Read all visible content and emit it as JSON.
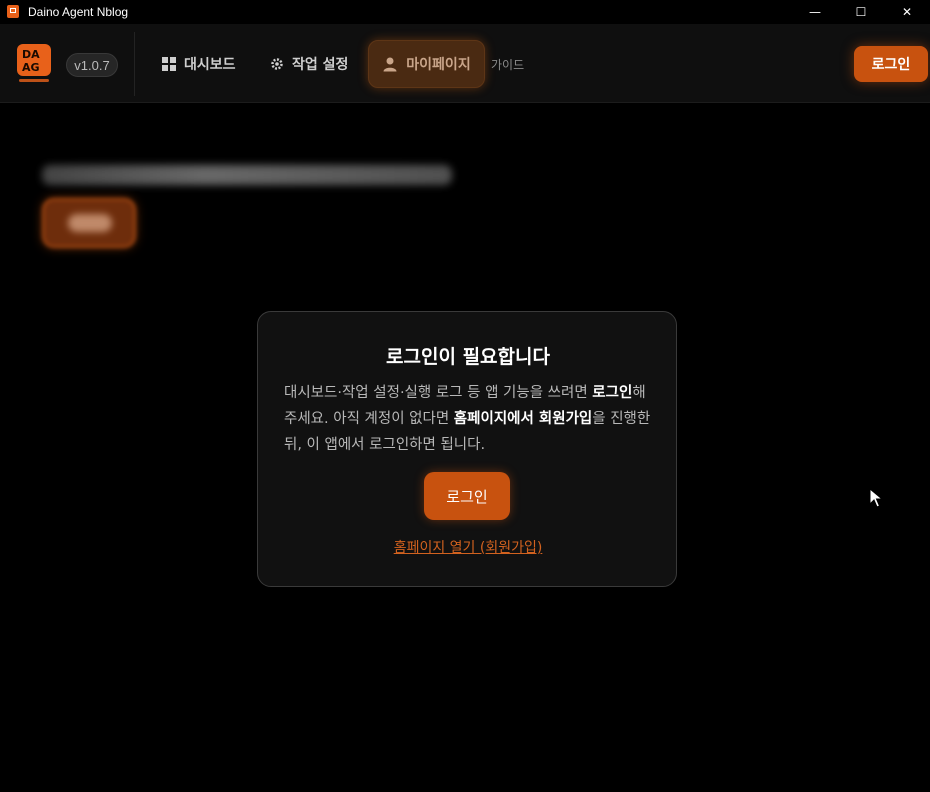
{
  "window": {
    "title": "Daino Agent Nblog",
    "minimize_glyph": "—",
    "maximize_glyph": "☐",
    "close_glyph": "✕"
  },
  "header": {
    "version": "v1.0.7",
    "nav": {
      "dashboard": "대시보드",
      "settings": "작업 설정",
      "mypage": "마이페이지",
      "guide": "가이드"
    },
    "login_label": "로그인"
  },
  "modal": {
    "title": "로그인이 필요합니다",
    "desc_1": "대시보드·작업 설정·실행 로그 등 앱 기능을 쓰려면 ",
    "desc_bold_1": "로그인",
    "desc_2": "해 주세요. 아직 계정이 없다면 ",
    "desc_bold_2": "홈페이지에서 회원가입",
    "desc_3": "을 진행한 뒤, 이 앱에서 로그인하면 됩니다.",
    "login_label": "로그인",
    "homepage_link": "홈페이지 열기 (회원가입)"
  },
  "icons": {
    "app": "app-logo-icon",
    "dashboard": "grid-icon",
    "settings": "gear-icon",
    "mypage": "user-icon"
  },
  "colors": {
    "accent": "#c8520f",
    "link": "#d2621f",
    "modal_bg": "#111111"
  }
}
